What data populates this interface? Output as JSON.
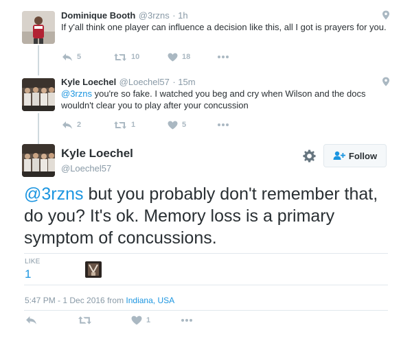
{
  "reply1": {
    "name": "Dominique Booth",
    "handle": "@3rzns",
    "time": "· 1h",
    "text": "If y'all think one player can influence a decision like this, all I got is prayers for you.",
    "replies": "5",
    "retweets": "10",
    "likes": "18"
  },
  "reply2": {
    "name": "Kyle Loechel",
    "handle": "@Loechel57",
    "time": "· 15m",
    "mention": "@3rzns",
    "text": " you're so fake. I watched you beg and cry when Wilson and the docs wouldn't clear you to play after your concussion",
    "replies": "2",
    "retweets": "1",
    "likes": "5"
  },
  "main": {
    "name": "Kyle Loechel",
    "handle": "@Loechel57",
    "follow_label": "Follow",
    "mention": "@3rzns",
    "text": " but you probably don't remember that, do you? It's ok. Memory loss is a primary symptom of concussions.",
    "like_label": "LIKE",
    "like_count": "1",
    "timestamp": "5:47 PM - 1 Dec 2016 from ",
    "location": "Indiana, USA",
    "likes": "1"
  },
  "colors": {
    "accent": "#1b95e0",
    "muted": "#aab8c2",
    "text": "#292f33"
  }
}
